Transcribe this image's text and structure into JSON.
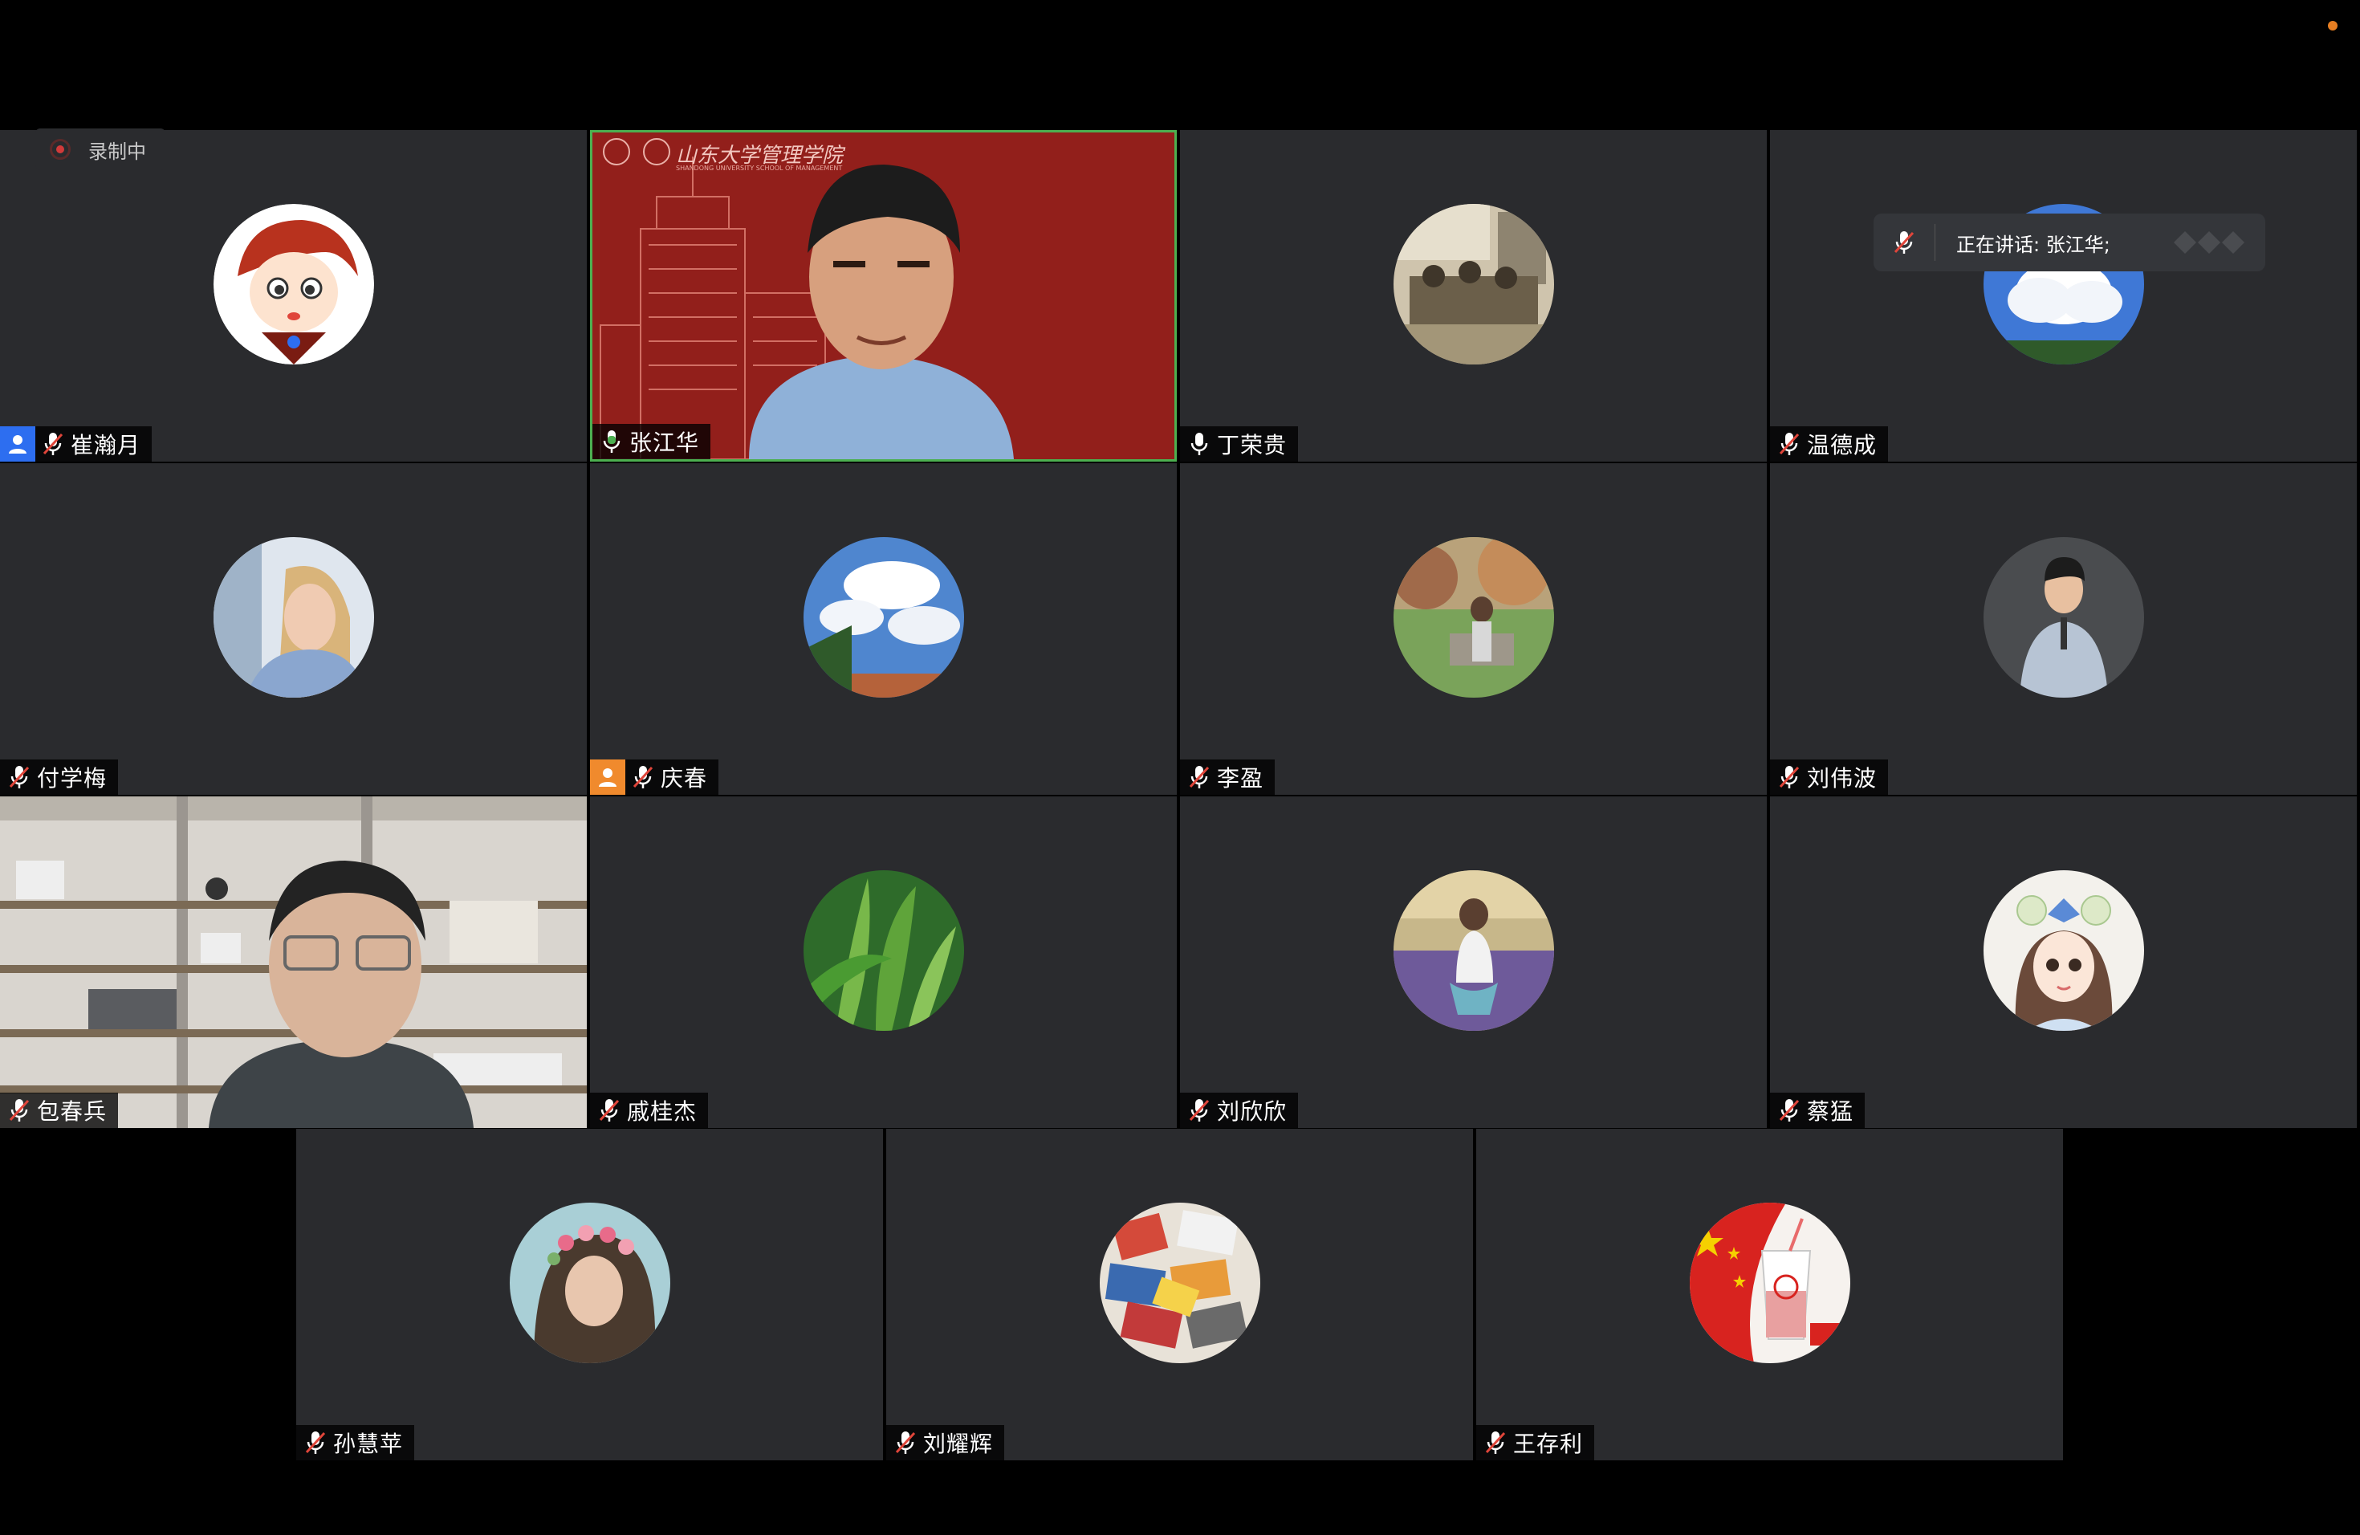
{
  "recording": {
    "label": "录制中"
  },
  "speaking": {
    "label": "正在讲话: 张江华;"
  },
  "video_content": {
    "banner_text": "山东大学管理学院",
    "banner_subtext": "SHANDONG UNIVERSITY SCHOOL OF MANAGEMENT"
  },
  "participants": [
    {
      "name": "崔瀚月",
      "mic": "muted",
      "badge": "host"
    },
    {
      "name": "张江华",
      "mic": "speaking",
      "active": true
    },
    {
      "name": "丁荣贵",
      "mic": "on"
    },
    {
      "name": "温德成",
      "mic": "muted"
    },
    {
      "name": "付学梅",
      "mic": "muted"
    },
    {
      "name": "庆春",
      "mic": "muted",
      "badge": "cohost"
    },
    {
      "name": "李盈",
      "mic": "muted"
    },
    {
      "name": "刘伟波",
      "mic": "muted"
    },
    {
      "name": "包春兵",
      "mic": "muted"
    },
    {
      "name": "戚桂杰",
      "mic": "muted"
    },
    {
      "name": "刘欣欣",
      "mic": "muted"
    },
    {
      "name": "蔡猛",
      "mic": "muted"
    },
    {
      "name": "孙慧苹",
      "mic": "muted"
    },
    {
      "name": "刘耀辉",
      "mic": "muted"
    },
    {
      "name": "王存利",
      "mic": "muted"
    }
  ],
  "colors": {
    "tile_bg": "#2a2b2e",
    "active_border": "#4caf50",
    "host_badge": "#2d6ef0",
    "cohost_badge": "#f08a2d",
    "muted_slash": "#e0453a"
  }
}
